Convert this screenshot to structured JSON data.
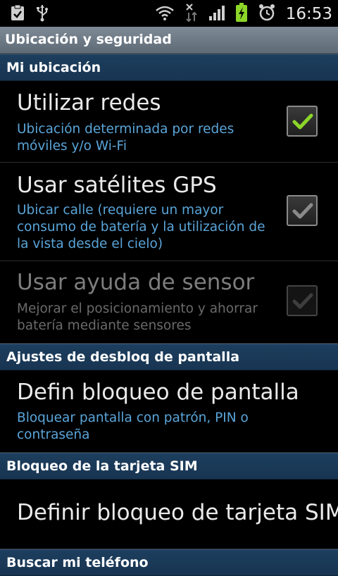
{
  "status_bar": {
    "time": "16:53",
    "icons": [
      "clipboard-check-icon",
      "usb-icon",
      "wifi-icon",
      "data-transfer-icon",
      "signal-icon",
      "battery-charging-icon",
      "alarm-icon"
    ]
  },
  "title_bar": {
    "title": "Ubicación y seguridad"
  },
  "sections": {
    "mi_ubicacion": "Mi ubicación",
    "desbloqueo": "Ajustes de desbloq de pantalla",
    "sim": "Bloqueo de la tarjeta SIM",
    "buscar": "Buscar mi teléfono"
  },
  "rows": {
    "redes": {
      "title": "Utilizar redes",
      "summary": "Ubicación determinada por redes móviles y/o Wi-Fi",
      "checked": true,
      "enabled": true
    },
    "gps": {
      "title": "Usar satélites GPS",
      "summary": "Ubicar calle (requiere un mayor consumo de batería y la utilización de la vista desde el cielo)",
      "checked": true,
      "enabled": true
    },
    "sensor": {
      "title": "Usar ayuda de sensor",
      "summary": "Mejorar el posicionamiento y ahorrar batería mediante sensores",
      "checked": true,
      "enabled": false
    },
    "bloqueo_pantalla": {
      "title": "Defin bloqueo de pantalla",
      "summary": "Bloquear pantalla con patrón, PIN o contraseña"
    },
    "bloqueo_sim": {
      "title": "Definir bloqueo de tarjeta SIM"
    }
  },
  "colors": {
    "accent_check": "#8bd629",
    "summary_text": "#5aa5d9",
    "section_bg": "#1d3e5e"
  }
}
